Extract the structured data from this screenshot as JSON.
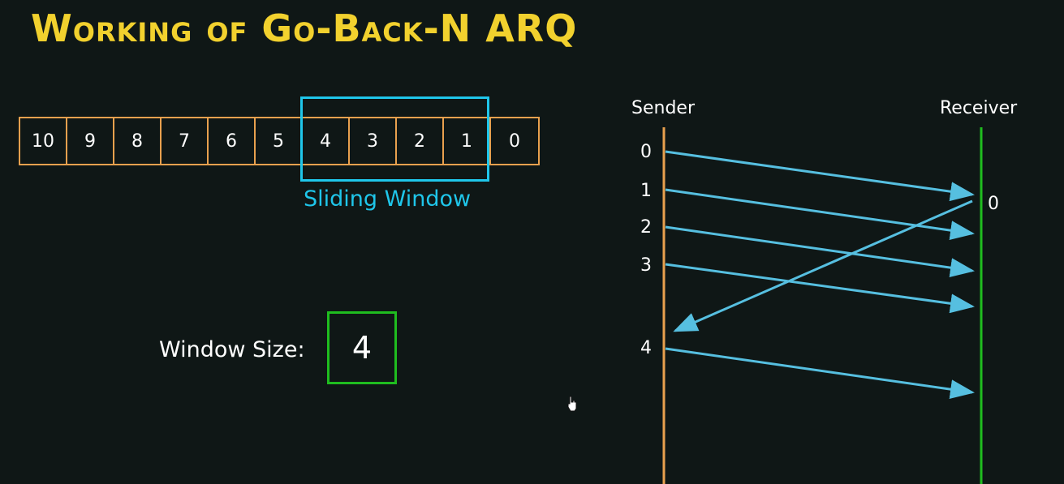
{
  "title": "Working of Go-Back-N ARQ",
  "frames": [
    "10",
    "9",
    "8",
    "7",
    "6",
    "5",
    "4",
    "3",
    "2",
    "1",
    "0"
  ],
  "sliding_window": {
    "label": "Sliding Window",
    "covers_frames": [
      "4",
      "3",
      "2",
      "1"
    ]
  },
  "window_size": {
    "label": "Window Size:",
    "value": "4"
  },
  "sequence_diagram": {
    "sender_label": "Sender",
    "receiver_label": "Receiver",
    "sender_seq_labels": [
      "0",
      "1",
      "2",
      "3",
      "4"
    ],
    "receiver_ack_label": "0",
    "messages": [
      {
        "direction": "sender-to-receiver",
        "frame": "0"
      },
      {
        "direction": "sender-to-receiver",
        "frame": "1"
      },
      {
        "direction": "sender-to-receiver",
        "frame": "2"
      },
      {
        "direction": "sender-to-receiver",
        "frame": "3"
      },
      {
        "direction": "receiver-to-sender",
        "ack": "0"
      },
      {
        "direction": "sender-to-receiver",
        "frame": "4"
      }
    ]
  },
  "colors": {
    "background": "#0f1716",
    "title": "#f2d12e",
    "frame_border": "#e8a04e",
    "window_border": "#1fc6ea",
    "arrow": "#56bfe0",
    "sender_line": "#e8a04e",
    "receiver_line": "#1fbd1f",
    "size_box": "#1fbd1f"
  },
  "icons": {
    "cursor": "hand-pointer-icon"
  }
}
